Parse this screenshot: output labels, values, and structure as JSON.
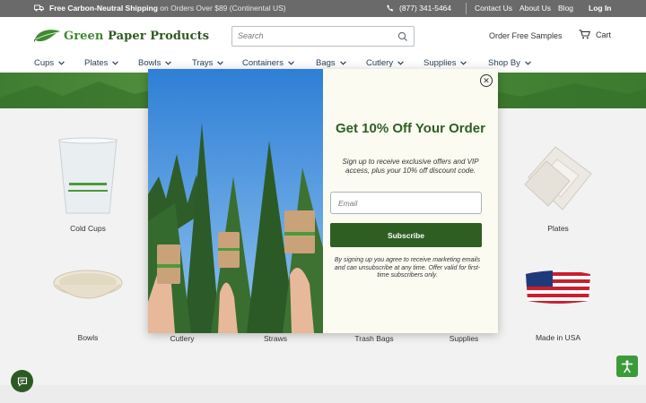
{
  "topbar": {
    "shipping_bold": "Free Carbon-Neutral Shipping",
    "shipping_rest": "on Orders Over $89 (Continental US)",
    "phone": "(877) 341-5464",
    "links": [
      "Contact Us",
      "About Us",
      "Blog"
    ],
    "login": "Log In"
  },
  "header": {
    "logo_prefix": "Green",
    "logo_rest": " Paper Products",
    "search_placeholder": "Search",
    "samples": "Order Free Samples",
    "cart": "Cart"
  },
  "nav": [
    "Cups",
    "Plates",
    "Bowls",
    "Trays",
    "Containers",
    "Bags",
    "Cutlery",
    "Supplies",
    "Shop By"
  ],
  "categories": {
    "row1": [
      "Cold Cups",
      "Plates"
    ],
    "row2": [
      "Bowls",
      "Cutlery",
      "Straws",
      "Trash Bags",
      "Supplies",
      "Made in USA"
    ]
  },
  "modal": {
    "title": "Get 10% Off Your Order",
    "description": "Sign up to receive exclusive offers and VIP access, plus your 10% off discount code.",
    "email_placeholder": "Email",
    "button": "Subscribe",
    "fine_print": "By signing up you agree to receive marketing emails and can unsubscribe at any time. Offer valid for first-time subscribers only.",
    "close": "✕"
  },
  "colors": {
    "brand_green": "#2f5e23",
    "topbar": "#6a6a6a",
    "nav_text": "#2a3f55"
  }
}
